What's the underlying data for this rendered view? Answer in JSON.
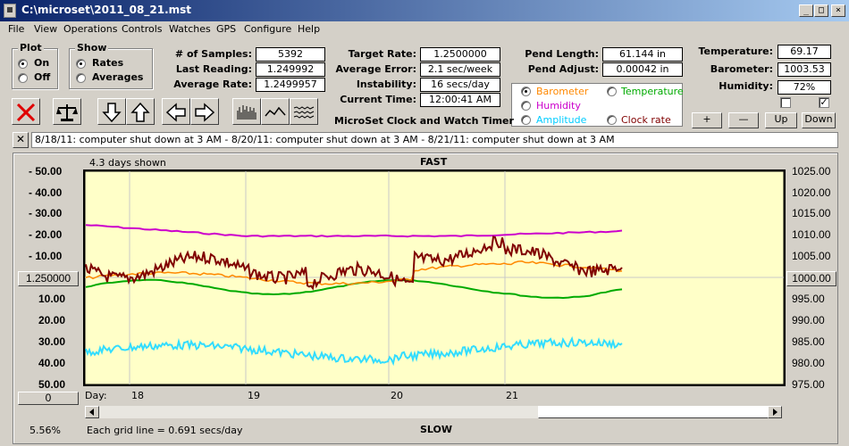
{
  "window": {
    "title": "C:\\microset\\2011_08_21.mst"
  },
  "menu": [
    "File",
    "View",
    "Operations",
    "Controls",
    "Watches",
    "GPS",
    "Configure",
    "Help"
  ],
  "plot_group": {
    "label": "Plot",
    "on": "On",
    "off": "Off",
    "selected": "On"
  },
  "show_group": {
    "label": "Show",
    "rates": "Rates",
    "averages": "Averages",
    "selected": "Rates"
  },
  "stats": {
    "samples_label": "# of Samples:",
    "samples": "5392",
    "last_reading_label": "Last Reading:",
    "last_reading": "1.249992",
    "average_rate_label": "Average Rate:",
    "average_rate": "1.2499957",
    "target_rate_label": "Target Rate:",
    "target_rate": "1.2500000",
    "average_error_label": "Average Error:",
    "average_error": "2.1 sec/week",
    "instability_label": "Instability:",
    "instability": "16 secs/day",
    "current_time_label": "Current Time:",
    "current_time": "12:00:41 AM",
    "pend_length_label": "Pend Length:",
    "pend_length": "61.144 in",
    "pend_adjust_label": "Pend Adjust:",
    "pend_adjust": "0.00042 in",
    "temperature_label": "Temperature:",
    "temperature": "69.17",
    "barometer_label": "Barometer:",
    "barometer": "1003.53",
    "humidity_label": "Humidity:",
    "humidity": "72%"
  },
  "series_select": {
    "barometer": "Barometer",
    "temperature": "Temperature",
    "humidity": "Humidity",
    "amplitude": "Amplitude",
    "clock_rate": "Clock rate",
    "selected": "Barometer"
  },
  "app_caption": "MicroSet Clock and Watch Timer",
  "adjust_buttons": {
    "plus": "+",
    "minus": "—",
    "up": "Up",
    "down": "Down"
  },
  "notes": "8/18/11: computer shut down at 3 AM - 8/20/11: computer shut down at 3 AM  -  8/21/11: computer shut down at 3 AM",
  "plot": {
    "days_shown": "4.3 days shown",
    "top_label": "FAST",
    "bottom_label": "SLOW",
    "left_center_button": "1.250000",
    "right_center_button": "1000.00",
    "left_bottom_button": "0",
    "day_label": "Day:",
    "grid_note": "Each grid line = 0.691 secs/day",
    "percent": "5.56%",
    "left_ticks_fast": [
      "- 50.00",
      "- 40.00",
      "- 30.00",
      "- 20.00",
      "- 10.00"
    ],
    "left_ticks_slow": [
      "10.00",
      "20.00",
      "30.00",
      "40.00",
      "50.00"
    ],
    "right_ticks": [
      "1025.00",
      "1020.00",
      "1015.00",
      "1010.00",
      "1005.00",
      "995.00",
      "990.00",
      "985.00",
      "980.00",
      "975.00"
    ],
    "day_ticks": [
      "18",
      "19",
      "20",
      "21"
    ]
  },
  "colors": {
    "plot_bg": "#ffffc8",
    "rate": "#800000",
    "barometer": "#ff8800",
    "temperature": "#00aa00",
    "humidity": "#cc00cc",
    "amplitude": "#00ccff"
  }
}
